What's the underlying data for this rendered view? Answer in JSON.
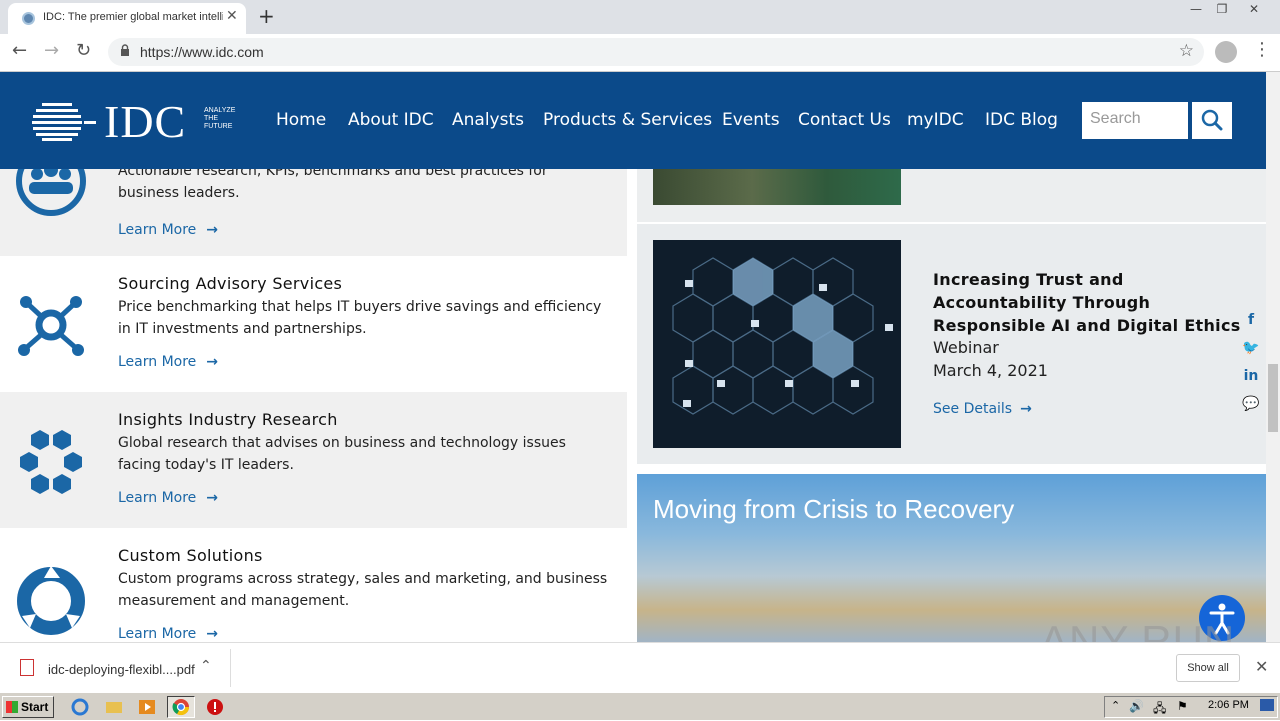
{
  "browser": {
    "tab_title": "IDC: The premier global market intelligence",
    "new_tab": "+",
    "url": "https://www.idc.com",
    "window_controls": [
      "—",
      "❐",
      "✕"
    ]
  },
  "site": {
    "logo_text": "IDC",
    "logo_tagline": [
      "ANALYZE",
      "THE",
      "FUTURE"
    ],
    "nav": [
      "Home",
      "About IDC",
      "Analysts",
      "Products & Services",
      "Events",
      "Contact Us",
      "myIDC",
      "IDC Blog"
    ],
    "search_placeholder": "Search"
  },
  "services": [
    {
      "title": "",
      "desc": "Actionable research, KPIs, benchmarks and best practices for business leaders.",
      "link": "Learn More",
      "icon": "people-cycle-icon"
    },
    {
      "title": "Sourcing Advisory Services",
      "desc": "Price benchmarking that helps IT buyers drive savings and efficiency in IT investments and partnerships.",
      "link": "Learn More",
      "icon": "network-hub-icon"
    },
    {
      "title": "Insights Industry Research",
      "desc": "Global research that advises on business and technology issues facing today's IT leaders.",
      "link": "Learn More",
      "icon": "hexagon-cluster-icon"
    },
    {
      "title": "Custom Solutions",
      "desc": "Custom programs across strategy, sales and marketing, and business measurement and management.",
      "link": "Learn More",
      "icon": "cycle-arrows-icon"
    }
  ],
  "events": {
    "card2": {
      "title": "Increasing Trust and Accountability Through Responsible AI and Digital Ethics",
      "type": "Webinar",
      "date": "March 4, 2021",
      "link": "See Details"
    },
    "banner": "Moving from Crisis to Recovery"
  },
  "social": [
    "f",
    "t",
    "in",
    "wc"
  ],
  "watermark": "ANY RUN",
  "download": {
    "filename": "idc-deploying-flexibl....pdf",
    "show_all": "Show all"
  },
  "taskbar": {
    "start": "Start",
    "clock": "2:06 PM"
  },
  "colors": {
    "brand_blue": "#0b4a8a",
    "link_blue": "#1b67a6"
  }
}
